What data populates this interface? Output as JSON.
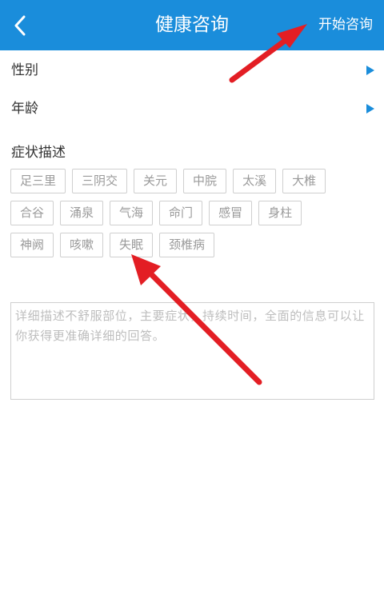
{
  "header": {
    "title": "健康咨询",
    "action_label": "开始咨询",
    "background": "#1a8ddb"
  },
  "form": {
    "gender_label": "性别",
    "age_label": "年龄",
    "symptom_label": "症状描述"
  },
  "tags": [
    [
      "足三里",
      "三阴交",
      "关元",
      "中脘",
      "太溪",
      "大椎"
    ],
    [
      "合谷",
      "涌泉",
      "气海",
      "命门",
      "感冒",
      "身柱"
    ],
    [
      "神阙",
      "咳嗽",
      "失眠",
      "颈椎病"
    ]
  ],
  "description": {
    "placeholder": "详细描述不舒服部位，主要症状，持续时间，全面的信息可以让你获得更准确详细的回答。"
  },
  "annotations": {
    "arrow_color": "#e31e24"
  }
}
